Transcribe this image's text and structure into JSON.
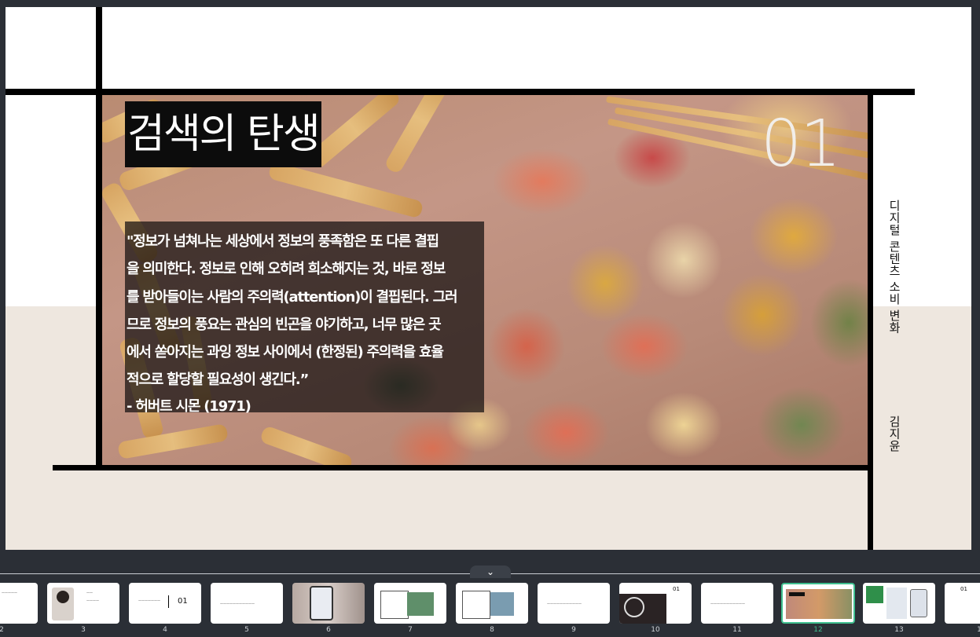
{
  "slide": {
    "title": "검색의 탄생",
    "number": "01",
    "quote_lines": [
      "\"정보가 넘쳐나는 세상에서 정보의 풍족함은 또 다른 결핍",
      "을 의미한다. 정보로 인해 오히려 희소해지는 것, 바로 정보",
      "를 받아들이는 사람의 주의력(attention)이 결핍된다. 그러",
      "므로 정보의 풍요는 관심의 빈곤을 야기하고, 너무 많은 곳",
      "에서 쏟아지는 과잉 정보 사이에서 (한정된) 주의력을 효율",
      "적으로 할당할 필요성이 생긴다.”",
      "- 허버트 시몬 (1971)"
    ],
    "side_title": "디지털 콘텐츠 소비 변화",
    "side_author": "김지윤"
  },
  "filmstrip": {
    "collapse_icon": "chevron-down-icon",
    "thumbnails": [
      {
        "num": "2",
        "text": "",
        "active": false
      },
      {
        "num": "3",
        "text": "",
        "active": false
      },
      {
        "num": "4",
        "text": "01",
        "active": false
      },
      {
        "num": "5",
        "text": "",
        "active": false
      },
      {
        "num": "6",
        "text": "",
        "active": false
      },
      {
        "num": "7",
        "text": "",
        "active": false
      },
      {
        "num": "8",
        "text": "",
        "active": false
      },
      {
        "num": "9",
        "text": "",
        "active": false
      },
      {
        "num": "10",
        "text": "01",
        "active": false
      },
      {
        "num": "11",
        "text": "",
        "active": false
      },
      {
        "num": "12",
        "text": "",
        "active": true
      },
      {
        "num": "13",
        "text": "",
        "active": false
      },
      {
        "num": "1",
        "text": "01",
        "active": false
      }
    ]
  },
  "colors": {
    "background": "#2b2f36",
    "beige": "#eee7df",
    "active_accent": "#3fbf8f"
  }
}
